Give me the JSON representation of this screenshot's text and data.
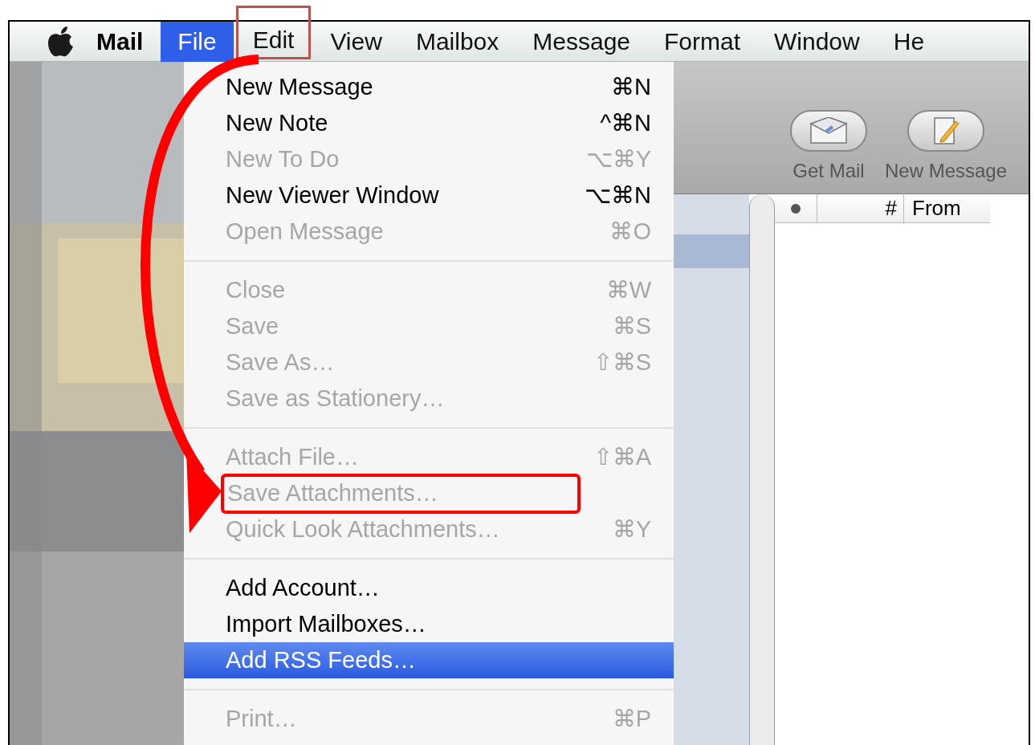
{
  "menu_bar": {
    "app_name": "Mail",
    "menus": [
      {
        "label": "File",
        "selected": true,
        "annotated": false
      },
      {
        "label": "Edit",
        "selected": false,
        "annotated": true
      },
      {
        "label": "View",
        "selected": false,
        "annotated": false
      },
      {
        "label": "Mailbox",
        "selected": false,
        "annotated": false
      },
      {
        "label": "Message",
        "selected": false,
        "annotated": false
      },
      {
        "label": "Format",
        "selected": false,
        "annotated": false
      },
      {
        "label": "Window",
        "selected": false,
        "annotated": false
      },
      {
        "label": "He",
        "selected": false,
        "annotated": false
      }
    ]
  },
  "file_menu": [
    {
      "kind": "item",
      "label": "New Message",
      "shortcut": "⌘N",
      "disabled": false,
      "selected": false,
      "annotated": false
    },
    {
      "kind": "item",
      "label": "New Note",
      "shortcut": "^⌘N",
      "disabled": false,
      "selected": false,
      "annotated": false
    },
    {
      "kind": "item",
      "label": "New To Do",
      "shortcut": "⌥⌘Y",
      "disabled": true,
      "selected": false,
      "annotated": false
    },
    {
      "kind": "item",
      "label": "New Viewer Window",
      "shortcut": "⌥⌘N",
      "disabled": false,
      "selected": false,
      "annotated": false
    },
    {
      "kind": "item",
      "label": "Open Message",
      "shortcut": "⌘O",
      "disabled": true,
      "selected": false,
      "annotated": false
    },
    {
      "kind": "separator"
    },
    {
      "kind": "item",
      "label": "Close",
      "shortcut": "⌘W",
      "disabled": true,
      "selected": false,
      "annotated": false
    },
    {
      "kind": "item",
      "label": "Save",
      "shortcut": "⌘S",
      "disabled": true,
      "selected": false,
      "annotated": false
    },
    {
      "kind": "item",
      "label": "Save As…",
      "shortcut": "⇧⌘S",
      "disabled": true,
      "selected": false,
      "annotated": false
    },
    {
      "kind": "item",
      "label": "Save as Stationery…",
      "disabled": true,
      "selected": false,
      "annotated": false
    },
    {
      "kind": "separator"
    },
    {
      "kind": "item",
      "label": "Attach File…",
      "shortcut": "⇧⌘A",
      "disabled": true,
      "selected": false,
      "annotated": false
    },
    {
      "kind": "item",
      "label": "Save Attachments…",
      "disabled": true,
      "selected": false,
      "annotated": true
    },
    {
      "kind": "item",
      "label": "Quick Look Attachments…",
      "shortcut": "⌘Y",
      "disabled": true,
      "selected": false,
      "annotated": false
    },
    {
      "kind": "separator"
    },
    {
      "kind": "item",
      "label": "Add Account…",
      "disabled": false,
      "selected": false,
      "annotated": false
    },
    {
      "kind": "item",
      "label": "Import Mailboxes…",
      "disabled": false,
      "selected": false,
      "annotated": false
    },
    {
      "kind": "item",
      "label": "Add RSS Feeds…",
      "disabled": false,
      "selected": true,
      "annotated": false
    },
    {
      "kind": "separator"
    },
    {
      "kind": "item",
      "label": "Print…",
      "shortcut": "⌘P",
      "disabled": true,
      "selected": false,
      "annotated": false
    }
  ],
  "toolbar": [
    {
      "label": "Get Mail",
      "kind": "get_mail"
    },
    {
      "label": "New Message",
      "kind": "compose"
    }
  ],
  "message_list": {
    "columns": [
      "#",
      "From"
    ]
  }
}
